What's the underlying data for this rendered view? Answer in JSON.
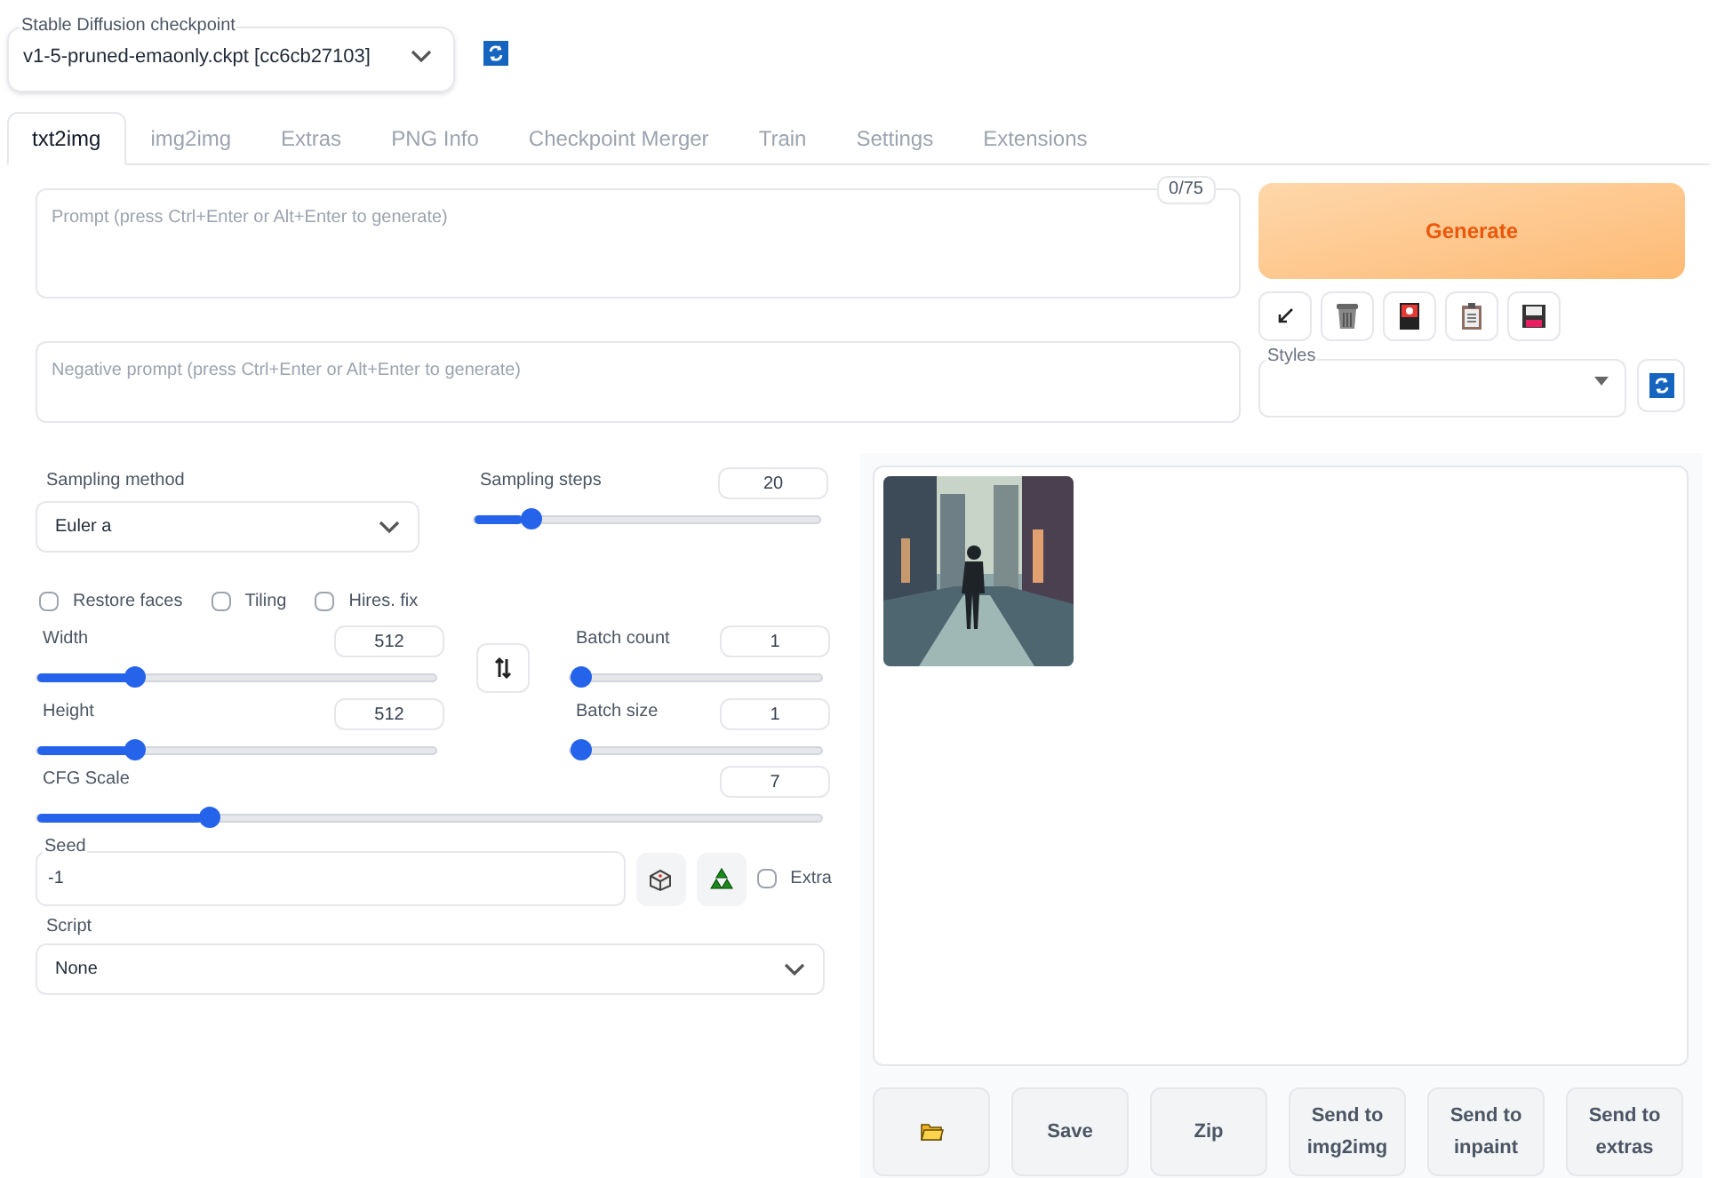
{
  "checkpoint": {
    "label": "Stable Diffusion checkpoint",
    "value": "v1-5-pruned-emaonly.ckpt [cc6cb27103]"
  },
  "tabs": [
    {
      "label": "txt2img",
      "selected": true
    },
    {
      "label": "img2img",
      "selected": false
    },
    {
      "label": "Extras",
      "selected": false
    },
    {
      "label": "PNG Info",
      "selected": false
    },
    {
      "label": "Checkpoint Merger",
      "selected": false
    },
    {
      "label": "Train",
      "selected": false
    },
    {
      "label": "Settings",
      "selected": false
    },
    {
      "label": "Extensions",
      "selected": false
    }
  ],
  "prompt": {
    "placeholder": "Prompt (press Ctrl+Enter or Alt+Enter to generate)",
    "token_count": "0/75"
  },
  "negative_prompt": {
    "placeholder": "Negative prompt (press Ctrl+Enter or Alt+Enter to generate)"
  },
  "generate_button": "Generate",
  "styles": {
    "label": "Styles"
  },
  "sampling_method": {
    "label": "Sampling method",
    "value": "Euler a"
  },
  "sampling_steps": {
    "label": "Sampling steps",
    "value": "20",
    "level": 0.14
  },
  "checkboxes": [
    {
      "label": "Restore faces",
      "checked": false
    },
    {
      "label": "Tiling",
      "checked": false
    },
    {
      "label": "Hires. fix",
      "checked": false
    }
  ],
  "width": {
    "label": "Width",
    "value": "512",
    "level": 0.23
  },
  "height": {
    "label": "Height",
    "value": "512",
    "level": 0.23
  },
  "batch_count": {
    "label": "Batch count",
    "value": "1",
    "level": 0
  },
  "batch_size": {
    "label": "Batch size",
    "value": "1",
    "level": 0
  },
  "cfg_scale": {
    "label": "CFG Scale",
    "value": "7",
    "level": 0.21
  },
  "seed": {
    "label": "Seed",
    "value": "-1"
  },
  "extra": {
    "label": "Extra",
    "checked": false
  },
  "script": {
    "label": "Script",
    "value": "None"
  },
  "action_buttons": [
    "Save",
    "Zip",
    "Send to img2img",
    "Send to inpaint",
    "Send to extras"
  ]
}
